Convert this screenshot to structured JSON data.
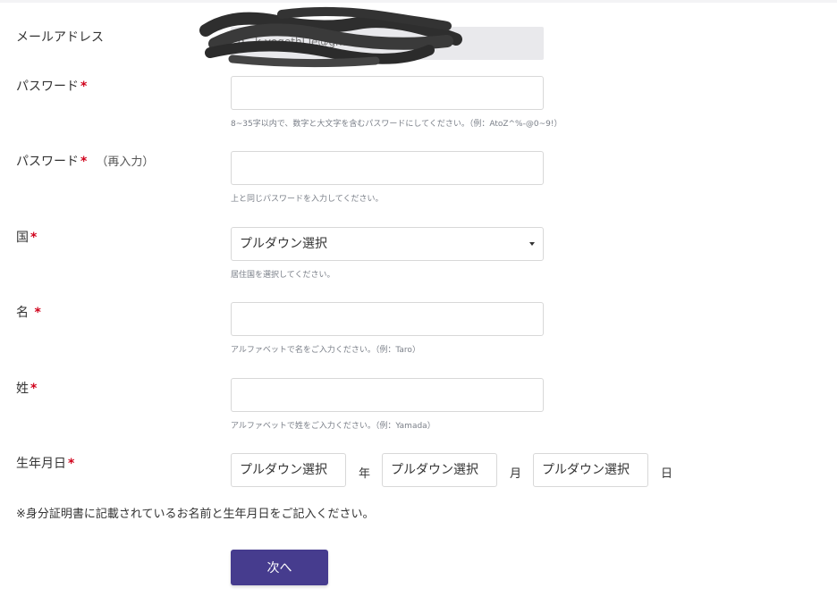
{
  "email": {
    "label": "メールアドレス",
    "value": "g...k.yogethl.le@gmail.com"
  },
  "password": {
    "label": "パスワード",
    "required_mark": "*",
    "value": "",
    "help": "8~35字以内で、数字と大文字を含むパスワードにしてください。（例：AtoZ^%-@0~9!）"
  },
  "password_confirm": {
    "label": "パスワード",
    "required_mark": "*",
    "sub_label": "（再入力）",
    "value": "",
    "help": "上と同じパスワードを入力してください。"
  },
  "country": {
    "label": "国",
    "required_mark": "*",
    "selected": "プルダウン選択",
    "help": "居住国を選択してください。"
  },
  "first_name": {
    "label": "名",
    "required_mark": "*",
    "value": "",
    "help": "アルファベットで名をご入力ください。（例：Taro）"
  },
  "last_name": {
    "label": "姓",
    "required_mark": "*",
    "value": "",
    "help": "アルファベットで姓をご入力ください。（例：Yamada）"
  },
  "birthdate": {
    "label": "生年月日",
    "required_mark": "*",
    "year_selected": "プルダウン選択",
    "year_unit": "年",
    "month_selected": "プルダウン選択",
    "month_unit": "月",
    "day_selected": "プルダウン選択",
    "day_unit": "日"
  },
  "note": "※身分証明書に記載されているお名前と生年月日をご記入ください。",
  "next_button": "次へ",
  "colors": {
    "required": "#d0021b",
    "button": "#463c8e",
    "help_text": "#7a7f88",
    "email_bg": "#e9e9ec"
  }
}
